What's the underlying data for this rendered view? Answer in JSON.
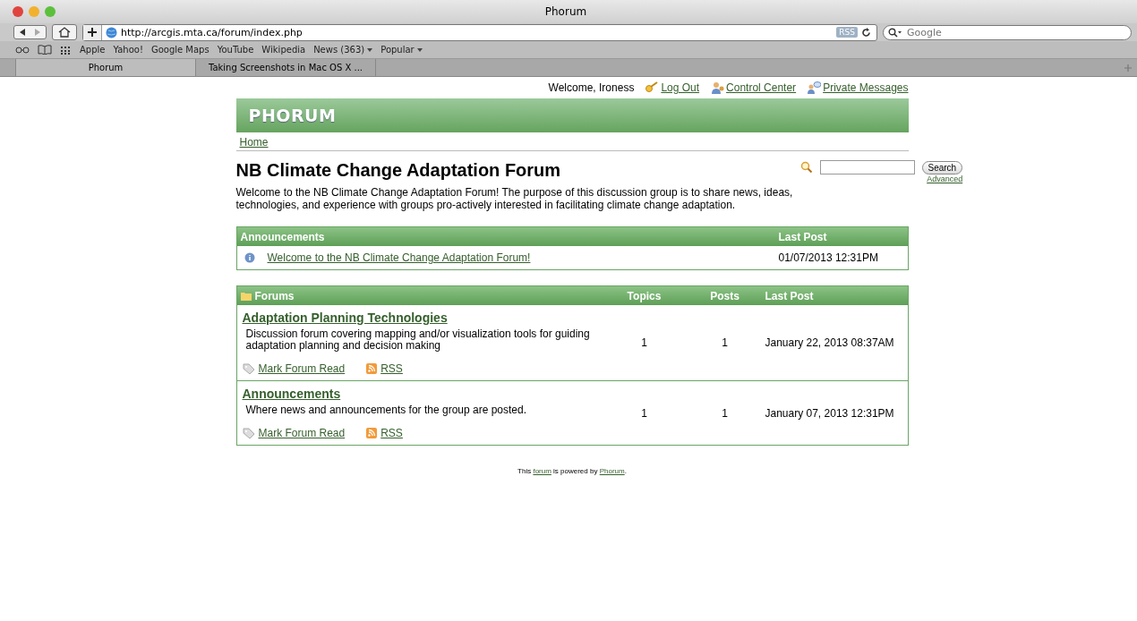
{
  "window": {
    "title": "Phorum"
  },
  "toolbar": {
    "url": "http://arcgis.mta.ca/forum/index.php",
    "rss_badge": "RSS",
    "search_placeholder": "Google"
  },
  "bookmarks": [
    {
      "label": "Apple",
      "menu": false
    },
    {
      "label": "Yahoo!",
      "menu": false
    },
    {
      "label": "Google Maps",
      "menu": false
    },
    {
      "label": "YouTube",
      "menu": false
    },
    {
      "label": "Wikipedia",
      "menu": false
    },
    {
      "label": "News (363)",
      "menu": true
    },
    {
      "label": "Popular",
      "menu": true
    }
  ],
  "tabs": [
    {
      "label": "Phorum",
      "selected": true
    },
    {
      "label": "Taking Screenshots in Mac OS X ...",
      "selected": false
    }
  ],
  "user_bar": {
    "welcome": "Welcome, Ironess",
    "links": [
      {
        "kind": "logout",
        "label": "Log Out"
      },
      {
        "kind": "control",
        "label": "Control Center"
      },
      {
        "kind": "messages",
        "label": "Private Messages"
      }
    ]
  },
  "logo": "PHORUM",
  "breadcrumb": "Home",
  "forum": {
    "title": "NB Climate Change Adaptation Forum",
    "description": "Welcome to the NB Climate Change Adaptation Forum! The purpose of this discussion group is to share news, ideas, technologies, and experience with groups pro-actively interested in facilitating climate change adaptation."
  },
  "search": {
    "button": "Search",
    "advanced": "Advanced"
  },
  "announcements": {
    "heading": "Announcements",
    "last_post_heading": "Last Post",
    "rows": [
      {
        "title": "Welcome to the NB Climate Change Adaptation Forum!",
        "last_post": "01/07/2013 12:31PM"
      }
    ]
  },
  "forums": {
    "heading": "Forums",
    "columns": [
      "Topics",
      "Posts",
      "Last Post"
    ],
    "rows": [
      {
        "name": "Adaptation Planning Technologies",
        "description": "Discussion forum covering mapping and/or visualization tools for guiding adaptation planning and decision making",
        "topics": "1",
        "posts": "1",
        "last_post": "January 22, 2013 08:37AM",
        "mark_read": "Mark Forum Read",
        "rss": "RSS"
      },
      {
        "name": "Announcements",
        "description": "Where news and announcements for the group are posted.",
        "topics": "1",
        "posts": "1",
        "last_post": "January 07, 2013 12:31PM",
        "mark_read": "Mark Forum Read",
        "rss": "RSS"
      }
    ]
  },
  "footer": {
    "before": "This ",
    "link1": "forum",
    "middle": " is powered by ",
    "link2": "Phorum",
    "after": "."
  }
}
